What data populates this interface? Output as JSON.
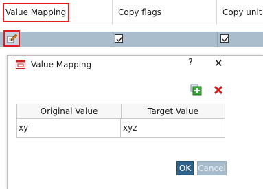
{
  "table": {
    "columns": [
      "Value Mapping",
      "Copy flags",
      "Copy unit"
    ]
  },
  "dialog": {
    "title": "Value Mapping",
    "help": "?",
    "close": "✕",
    "grid": {
      "headers": [
        "Original Value",
        "Target Value"
      ],
      "rows": [
        [
          "xy",
          "xyz"
        ]
      ]
    },
    "ok_label": "OK",
    "cancel_label": "Cancel"
  },
  "colors": {
    "highlight": "#e02020",
    "row_selected": "#a9bdcd",
    "ok_button": "#2e6189",
    "cancel_button_disabled": "#a6bccc",
    "delete_icon": "#d01818",
    "add_icon": "#2f9a2f"
  },
  "icons": {
    "edit": "pencil-edit-icon",
    "app": "app-window-icon",
    "add": "add-row-icon",
    "delete": "delete-x-icon",
    "checkbox": "checked-checkbox"
  }
}
